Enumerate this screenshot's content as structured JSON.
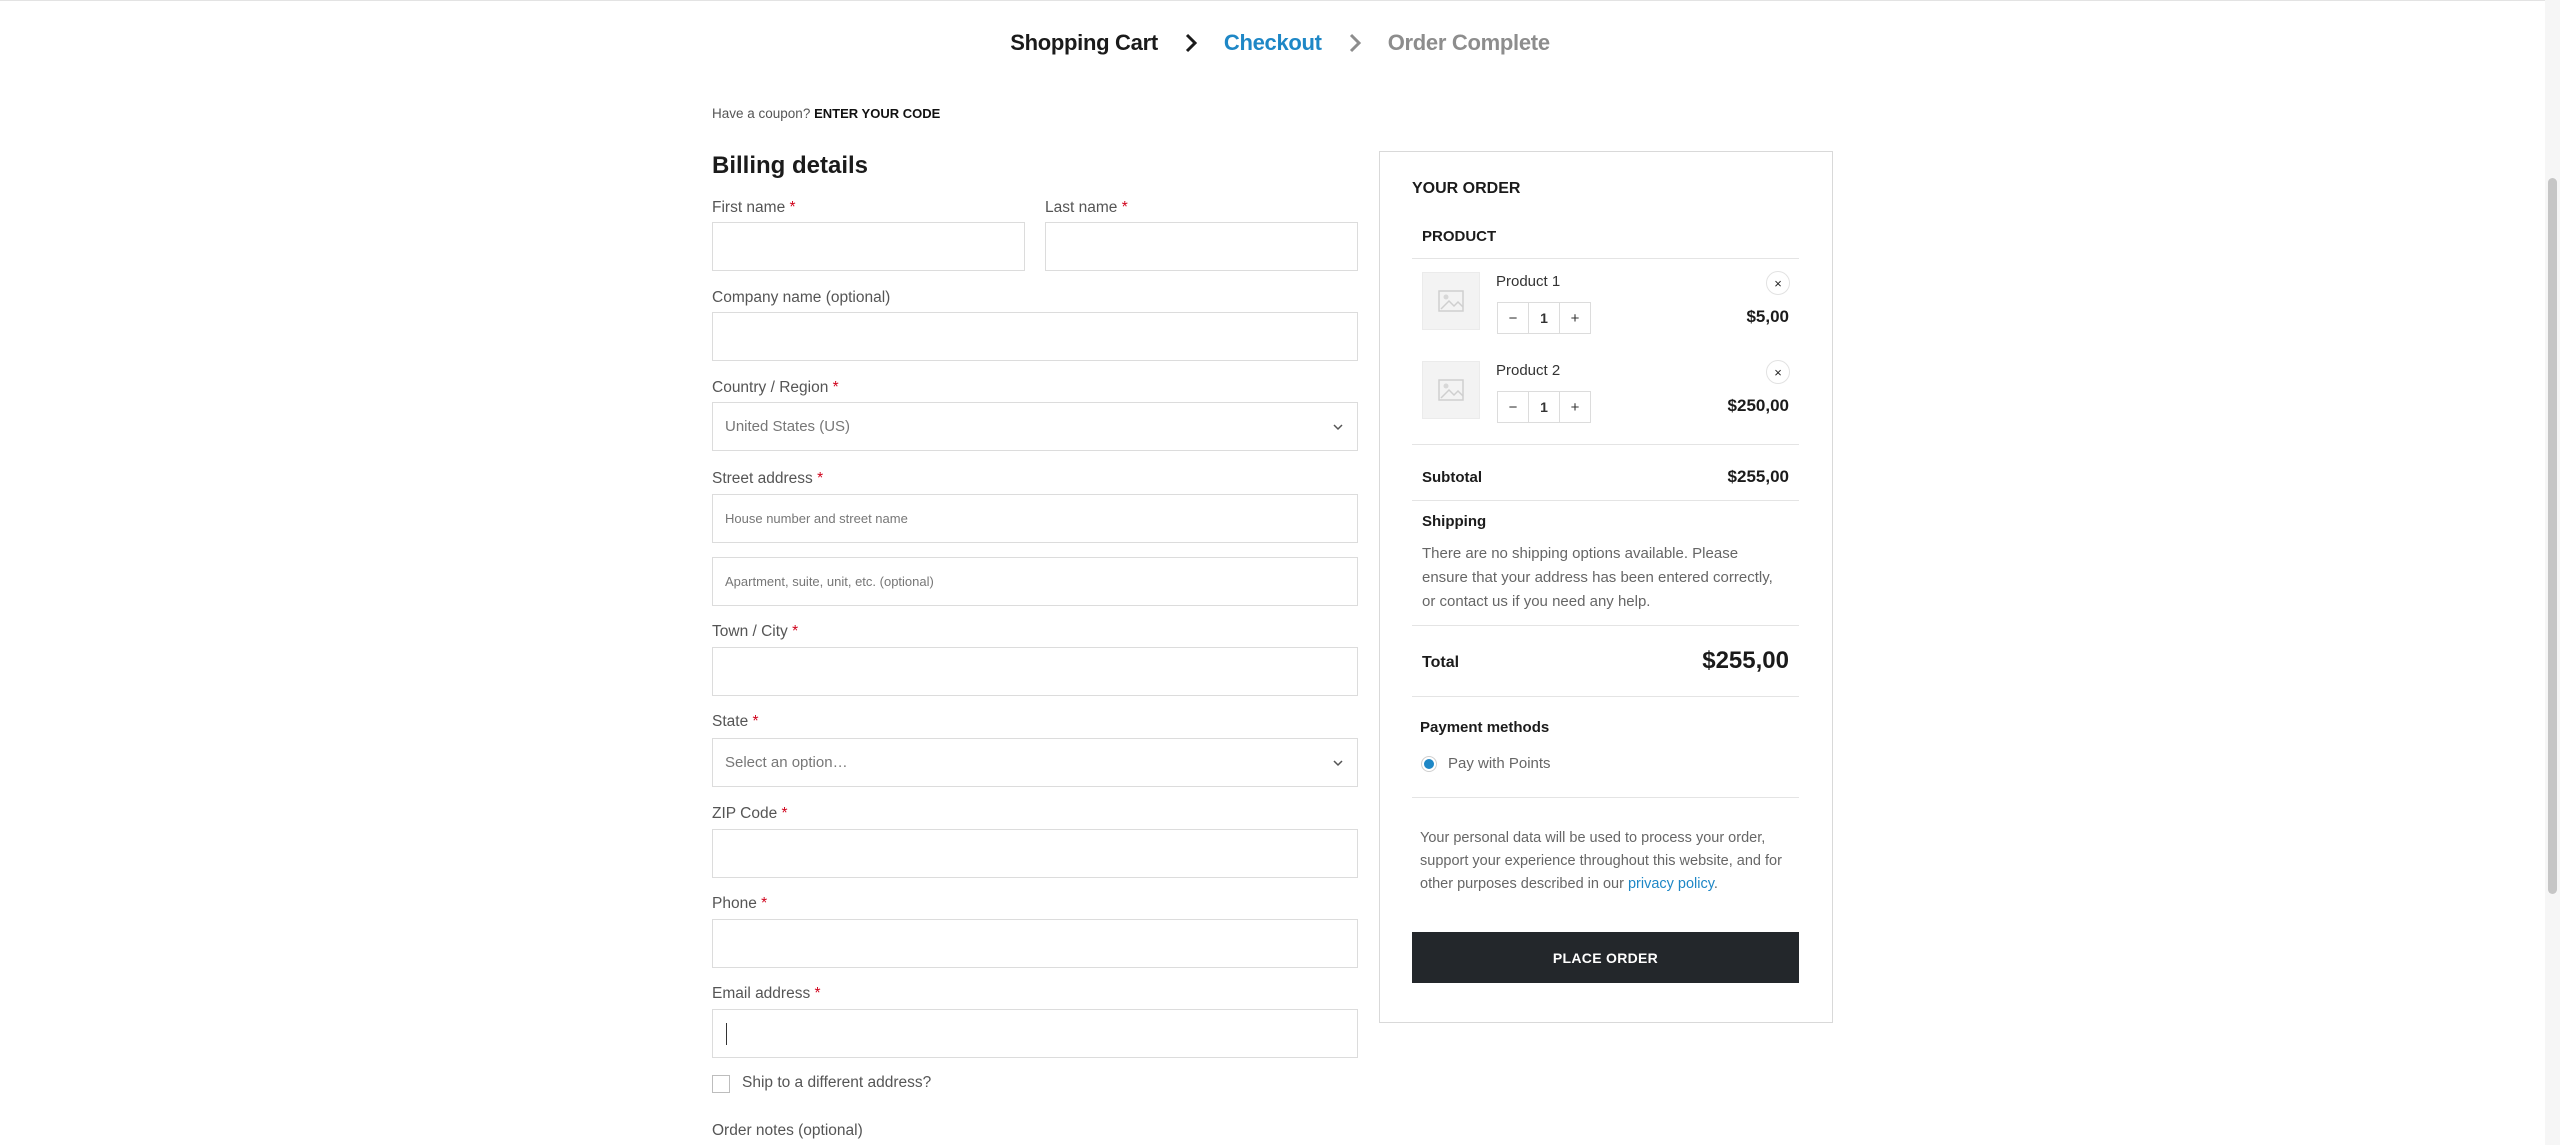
{
  "breadcrumb": {
    "step1": "Shopping Cart",
    "step2": "Checkout",
    "step3": "Order Complete",
    "active_color": "#1e87c6"
  },
  "coupon": {
    "prompt": "Have a coupon?",
    "link": "ENTER YOUR CODE"
  },
  "billing": {
    "title": "Billing details",
    "required_mark": "*",
    "first_name": {
      "label": "First name",
      "value": ""
    },
    "last_name": {
      "label": "Last name",
      "value": ""
    },
    "company": {
      "label": "Company name (optional)",
      "value": ""
    },
    "country": {
      "label": "Country / Region",
      "value": "United States (US)"
    },
    "street": {
      "label": "Street address",
      "placeholder1": "House number and street name",
      "placeholder2": "Apartment, suite, unit, etc. (optional)"
    },
    "city": {
      "label": "Town / City",
      "value": ""
    },
    "state": {
      "label": "State",
      "value": "Select an option…"
    },
    "zip": {
      "label": "ZIP Code",
      "value": ""
    },
    "phone": {
      "label": "Phone",
      "value": ""
    },
    "email": {
      "label": "Email address",
      "value": ""
    },
    "ship_different": "Ship to a different address?",
    "order_notes": "Order notes (optional)"
  },
  "order": {
    "title": "YOUR ORDER",
    "product_header": "PRODUCT",
    "items": [
      {
        "name": "Product 1",
        "qty": "1",
        "price": "$5,00",
        "remove": "×",
        "minus": "−",
        "plus": "+"
      },
      {
        "name": "Product 2",
        "qty": "1",
        "price": "$250,00",
        "remove": "×",
        "minus": "−",
        "plus": "+"
      }
    ],
    "subtotal_label": "Subtotal",
    "subtotal_value": "$255,00",
    "shipping_label": "Shipping",
    "shipping_note": "There are no shipping options available. Please ensure that your address has been entered correctly, or contact us if you need any help.",
    "total_label": "Total",
    "total_value": "$255,00",
    "payment_title": "Payment methods",
    "payment_option": "Pay with Points",
    "privacy_text": "Your personal data will be used to process your order, support your experience throughout this website, and for other purposes described in our",
    "privacy_link": "privacy policy",
    "privacy_end": ".",
    "place_order": "PLACE ORDER",
    "button_color": "#23272b"
  }
}
